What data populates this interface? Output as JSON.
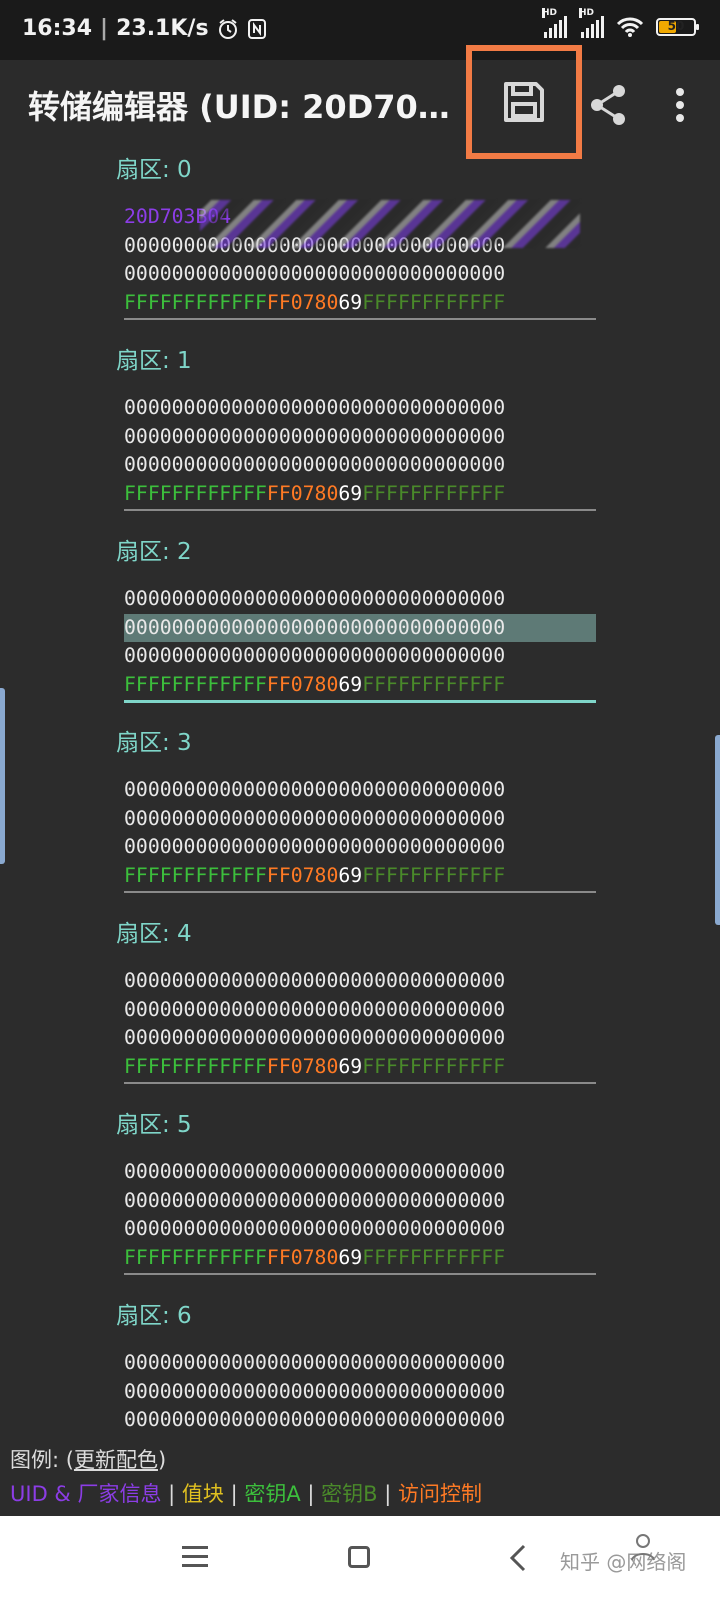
{
  "status": {
    "time": "16:34",
    "speed": "23.1K/s",
    "signal_tag": "HD",
    "battery": "50",
    "battery_level": 0.5
  },
  "appbar": {
    "title": "转储编辑器 (UID: 20D70…"
  },
  "sectors": [
    {
      "title": "扇区: 0",
      "uid_row": "20D703B04",
      "rows": [
        "00000000000000000000000000000000",
        "00000000000000000000000000000000"
      ]
    },
    {
      "title": "扇区: 1",
      "rows": [
        "00000000000000000000000000000000",
        "00000000000000000000000000000000",
        "00000000000000000000000000000000"
      ]
    },
    {
      "title": "扇区: 2",
      "rows": [
        "00000000000000000000000000000000",
        "00000000000000000000000000000000",
        "00000000000000000000000000000000"
      ]
    },
    {
      "title": "扇区: 3",
      "rows": [
        "00000000000000000000000000000000",
        "00000000000000000000000000000000",
        "00000000000000000000000000000000"
      ]
    },
    {
      "title": "扇区: 4",
      "rows": [
        "00000000000000000000000000000000",
        "00000000000000000000000000000000",
        "00000000000000000000000000000000"
      ]
    },
    {
      "title": "扇区: 5",
      "rows": [
        "00000000000000000000000000000000",
        "00000000000000000000000000000000",
        "00000000000000000000000000000000"
      ]
    },
    {
      "title": "扇区: 6",
      "rows": [
        "00000000000000000000000000000000",
        "00000000000000000000000000000000",
        "00000000000000000000000000000000"
      ]
    }
  ],
  "trailer": {
    "key_a": "FFFFFFFFFFFF",
    "access": "FF0780",
    "gpb": "69",
    "key_b": "FFFFFFFFFFFF"
  },
  "legend": {
    "label": "图例: (",
    "link": "更新配色",
    "close": ")",
    "uid": "UID & 厂家信息",
    "value": "值块",
    "key_a": "密钥A",
    "key_b": "密钥B",
    "access": "访问控制",
    "sep": " | "
  },
  "watermark": "知乎 @网络阁",
  "colors": {
    "uid": "#8c3de6",
    "value": "#e0c020",
    "key_a": "#3cbf3c",
    "key_b": "#4a8a2a",
    "access": "#ff7a24",
    "highlight": "#f27b45"
  }
}
